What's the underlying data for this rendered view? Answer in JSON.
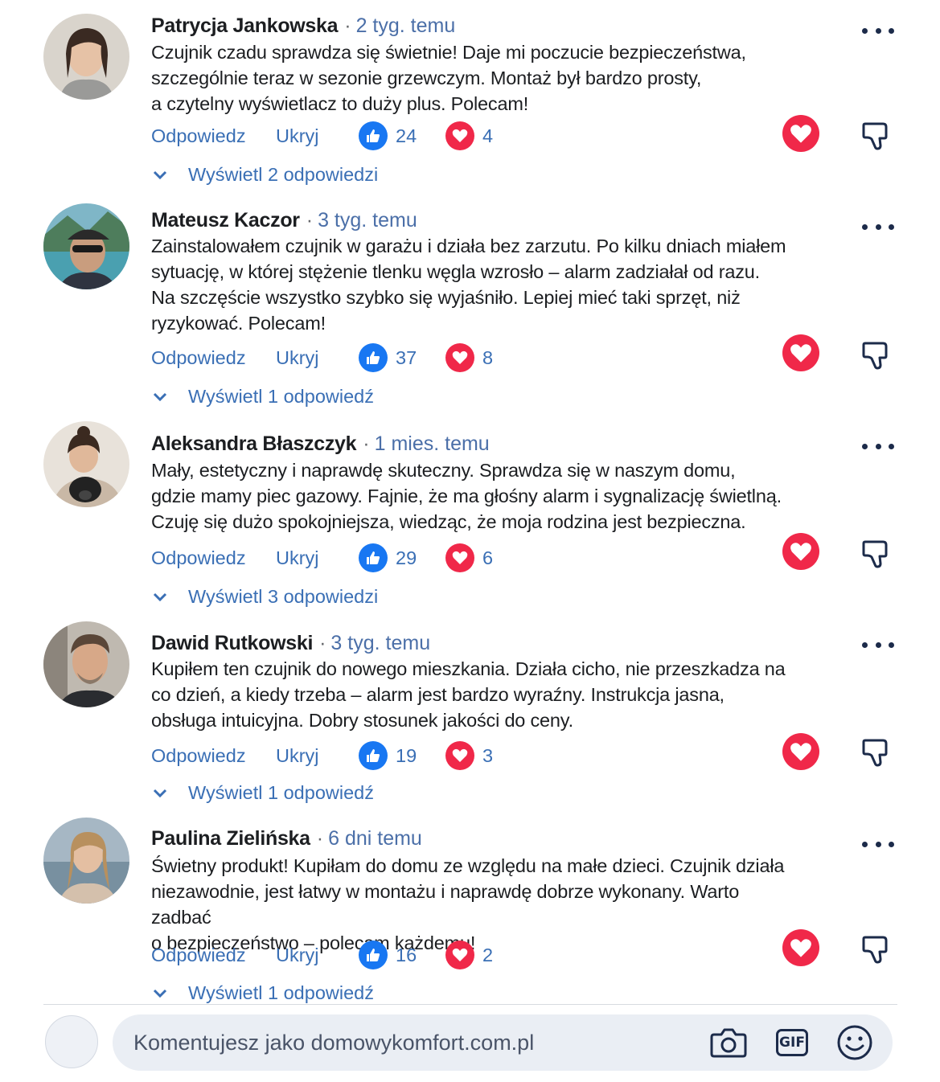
{
  "comments": [
    {
      "author": "Patrycja Jankowska",
      "time": "2 tyg. temu",
      "text": "Czujnik czadu sprawdza się świetnie! Daje mi poczucie bezpieczeństwa,\nszczególnie teraz w sezonie grzewczym.  Montaż był bardzo prosty,\na czytelny wyświetlacz to duży plus. Polecam!",
      "reply_label": "Odpowiedz",
      "hide_label": "Ukryj",
      "likes": "24",
      "hearts": "4",
      "view_replies": "Wyświetl 2 odpowiedzi"
    },
    {
      "author": "Mateusz Kaczor",
      "time": "3 tyg. temu",
      "text": "Zainstalowałem czujnik w garażu i działa bez zarzutu. Po kilku dniach miałem\nsytuację, w której stężenie tlenku węgla wzrosło – alarm zadziałał od razu.\nNa szczęście wszystko szybko się wyjaśniło. Lepiej mieć taki sprzęt, niż\nryzykować. Polecam!",
      "reply_label": "Odpowiedz",
      "hide_label": "Ukryj",
      "likes": "37",
      "hearts": "8",
      "view_replies": "Wyświetl 1 odpowiedź"
    },
    {
      "author": "Aleksandra Błaszczyk",
      "time": "1 mies. temu",
      "text": "Mały, estetyczny i naprawdę skuteczny. Sprawdza się w naszym domu,\ngdzie mamy piec gazowy. Fajnie, że ma głośny alarm i sygnalizację świetlną.\nCzuję się dużo spokojniejsza, wiedząc, że moja rodzina jest bezpieczna.",
      "reply_label": "Odpowiedz",
      "hide_label": "Ukryj",
      "likes": "29",
      "hearts": "6",
      "view_replies": "Wyświetl 3 odpowiedzi"
    },
    {
      "author": "Dawid Rutkowski",
      "time": "3 tyg. temu",
      "text": "Kupiłem ten czujnik do nowego mieszkania. Działa cicho, nie przeszkadza na\nco dzień, a kiedy trzeba – alarm jest bardzo wyraźny. Instrukcja jasna,\nobsługa intuicyjna. Dobry stosunek jakości do ceny.",
      "reply_label": "Odpowiedz",
      "hide_label": "Ukryj",
      "likes": "19",
      "hearts": "3",
      "view_replies": "Wyświetl 1 odpowiedź"
    },
    {
      "author": "Paulina Zielińska",
      "time": "6 dni temu",
      "text": "Świetny produkt! Kupiłam do domu ze względu na małe dzieci. Czujnik działa\nniezawodnie, jest łatwy w montażu i naprawdę dobrze wykonany. Warto zadbać\no bezpieczeństwo – polecam każdemu!",
      "reply_label": "Odpowiedz",
      "hide_label": "Ukryj",
      "likes": "16",
      "hearts": "2",
      "view_replies": "Wyświetl 1 odpowiedź"
    }
  ],
  "composer": {
    "placeholder": "Komentujesz jako domowykomfort.com.pl",
    "gif_label": "GIF"
  },
  "icons": {
    "like": "thumbs-up-icon",
    "heart": "heart-icon",
    "more": "more-options-icon",
    "dislike": "thumbs-down-icon",
    "expand": "chevron-down-icon",
    "camera": "camera-icon",
    "gif": "gif-icon",
    "emoji": "emoji-icon"
  },
  "colors": {
    "like_blue": "#1877f2",
    "heart_red": "#f02849",
    "link_blue": "#3a6fb5"
  }
}
